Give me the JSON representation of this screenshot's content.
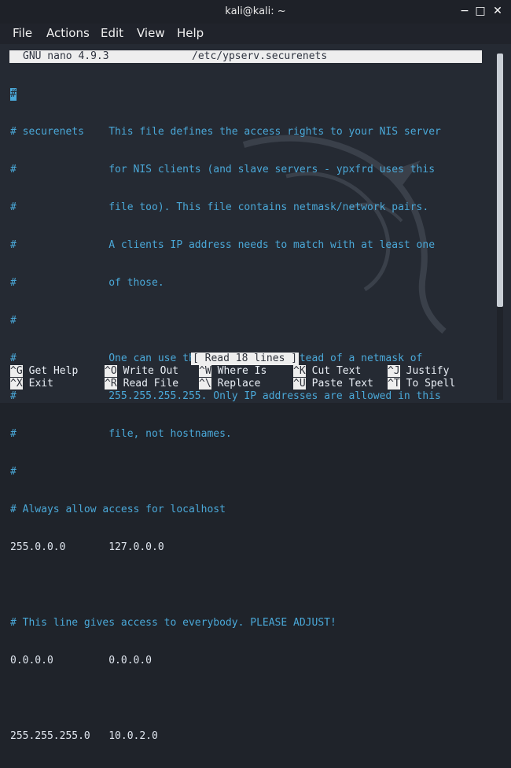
{
  "window": {
    "title": "kali@kali: ~",
    "minimize": "−",
    "maximize": "□",
    "close": "✕"
  },
  "menu": [
    "File",
    "Actions",
    "Edit",
    "View",
    "Help"
  ],
  "nano": {
    "version": "GNU nano 4.9.3",
    "filename": "/etc/ypserv.securenets",
    "cursor_char": "#",
    "lines": [
      "",
      "# securenets    This file defines the access rights to your NIS server",
      "#               for NIS clients (and slave servers - ypxfrd uses this",
      "#               file too). This file contains netmask/network pairs.",
      "#               A clients IP address needs to match with at least one",
      "#               of those.",
      "#",
      "#               One can use the word \"host\" instead of a netmask of",
      "#               255.255.255.255. Only IP addresses are allowed in this",
      "#               file, not hostnames.",
      "#",
      "# Always allow access for localhost",
      "255.0.0.0       127.0.0.0",
      "",
      "# This line gives access to everybody. PLEASE ADJUST!",
      "0.0.0.0         0.0.0.0",
      "",
      "255.255.255.0   10.0.2.0"
    ],
    "status": "[ Read 18 lines ]"
  },
  "shortcuts": [
    {
      "key": "^G",
      "label": "Get Help"
    },
    {
      "key": "^O",
      "label": "Write Out"
    },
    {
      "key": "^W",
      "label": "Where Is"
    },
    {
      "key": "^K",
      "label": "Cut Text"
    },
    {
      "key": "^J",
      "label": "Justify"
    },
    {
      "key": "^X",
      "label": "Exit"
    },
    {
      "key": "^R",
      "label": "Read File"
    },
    {
      "key": "^\\",
      "label": "Replace"
    },
    {
      "key": "^U",
      "label": "Paste Text"
    },
    {
      "key": "^T",
      "label": "To Spell"
    }
  ],
  "colors": {
    "terminal_bg": "#252a33",
    "comment": "#4aa8d8",
    "header_bg": "#eeeeee"
  }
}
